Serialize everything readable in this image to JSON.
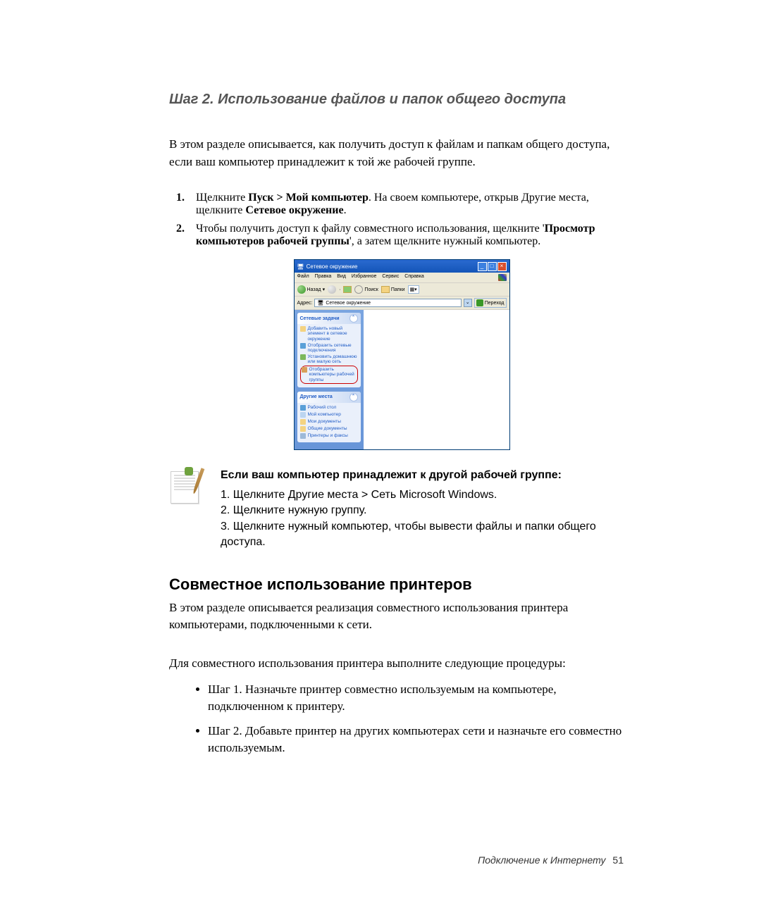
{
  "step_title": "Шаг 2. Использование файлов и папок общего доступа",
  "intro": "В этом разделе описывается, как получить доступ к файлам и папкам общего доступа, если ваш компьютер принадлежит к той же рабочей группе.",
  "steps": [
    {
      "num": "1.",
      "pre": "Щелкните ",
      "bold1": "Пуск > Мой компьютер",
      "mid": ". На своем компьютере, открыв Другие места, щелкните ",
      "bold2": "Сетевое окружение",
      "post": "."
    },
    {
      "num": "2.",
      "pre": "Чтобы получить доступ к файлу совместного использования, щелкните '",
      "bold1": "Просмотр компьютеров рабочей группы",
      "mid": "', а затем щелкните нужный компьютер.",
      "bold2": "",
      "post": ""
    }
  ],
  "xp": {
    "title": "Сетевое окружение",
    "menu": [
      "Файл",
      "Правка",
      "Вид",
      "Избранное",
      "Сервис",
      "Справка"
    ],
    "toolbar": {
      "back": "Назад",
      "search": "Поиск",
      "folders": "Папки"
    },
    "addr_label": "Адрес:",
    "addr_value": "Сетевое окружение",
    "go": "Переход",
    "panel1": {
      "title": "Сетевые задачи",
      "items": [
        "Добавить новый элемент в сетевое окружение",
        "Отобразить сетевые подключения",
        "Установить домашнюю или малую сеть",
        "Отобразить компьютеры рабочей группы"
      ]
    },
    "panel2": {
      "title": "Другие места",
      "items": [
        "Рабочий стол",
        "Мой компьютер",
        "Мои документы",
        "Общие документы",
        "Принтеры и факсы"
      ]
    }
  },
  "note": {
    "title": "Если ваш компьютер принадлежит к другой рабочей группе:",
    "l1": "1. Щелкните Другие места > Сеть Microsoft Windows.",
    "l2": "2. Щелкните нужную группу.",
    "l3": "3. Щелкните нужный компьютер, чтобы вывести файлы и папки общего доступа."
  },
  "h2": "Совместное использование принтеров",
  "p2": "В этом разделе описывается реализация совместного использования принтера компьютерами, подключенными к сети.",
  "p3": "Для совместного использования принтера выполните следующие процедуры:",
  "bullets": [
    "Шаг 1. Назначьте принтер совместно используемым на компьютере, подключенном к принтеру.",
    "Шаг 2. Добавьте принтер на других компьютерах сети и назначьте его совместно используемым."
  ],
  "footer": {
    "text": "Подключение к Интернету",
    "page": "51"
  }
}
